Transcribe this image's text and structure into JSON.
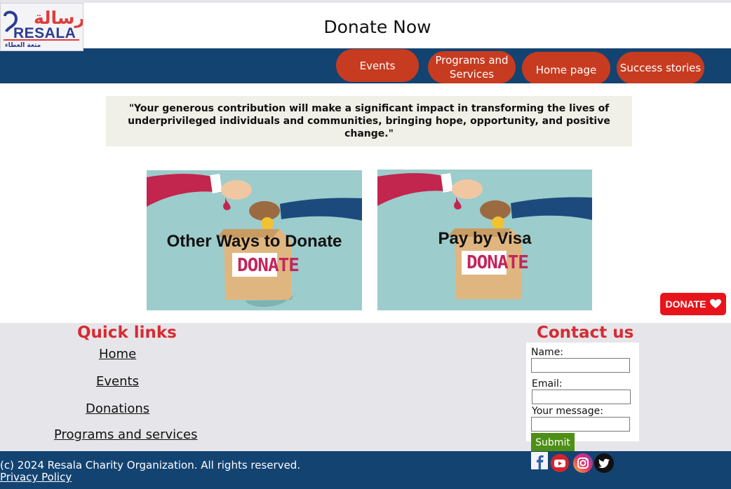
{
  "header": {
    "logo_latin": "RESALA",
    "logo_arabic": "رسالة",
    "logo_tagline": "متعة العطاء",
    "title": "Donate Now"
  },
  "nav": {
    "items": [
      {
        "label": "Events"
      },
      {
        "label": "Programs and Services"
      },
      {
        "label": "Home page"
      },
      {
        "label": "Success stories"
      }
    ]
  },
  "main": {
    "quote": "\"Your generous contribution will make a significant impact in transforming the lives of underprivileged individuals and communities, bringing hope, opportunity, and positive change.\"",
    "cards": [
      {
        "label": "Other Ways to Donate",
        "box_text": "DONATE"
      },
      {
        "label": "Pay by Visa",
        "box_text": "DONATE"
      }
    ],
    "floating_donate": "DONATE"
  },
  "footer": {
    "quick_links_title": "Quick links",
    "quick_links": [
      "Home",
      "Events",
      "Donations",
      "Programs and services"
    ],
    "contact_title": "Contact us",
    "form": {
      "name_label": "Name:",
      "email_label": "Email:",
      "message_label": "Your message:",
      "submit_label": "Submit"
    },
    "copyright": "(c) 2024 Resala Charity Organization. All rights reserved.",
    "privacy": "Privacy Policy",
    "social": [
      "facebook-icon",
      "youtube-icon",
      "instagram-icon",
      "twitter-icon"
    ]
  },
  "colors": {
    "nav_bg": "#134371",
    "nav_button": "#c73b20",
    "heading_red": "#d62b31",
    "submit_green": "#4e8f16",
    "donate_red": "#e8141c"
  }
}
